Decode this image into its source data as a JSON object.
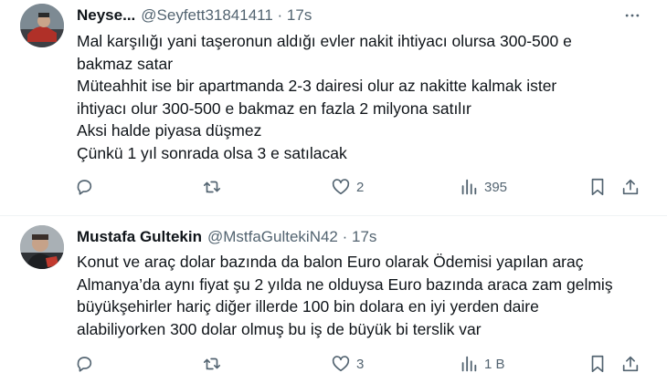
{
  "tweets": [
    {
      "display_name": "Neyse...",
      "handle_time": "@Seyfett31841411 · 17s",
      "lines": [
        "Mal karşılığı yani taşeronun aldığı evler nakit ihtiyacı olursa 300-500 e",
        "bakmaz satar",
        "Müteahhit ise bir apartmanda 2-3 dairesi olur az nakitte kalmak ister",
        "ihtiyacı olur 300-500 e bakmaz en fazla 2 milyona satılır",
        "Aksi halde piyasa düşmez",
        "Çünkü 1 yıl sonrada olsa 3 e satılacak"
      ],
      "replies": "",
      "retweets": "",
      "likes": "2",
      "views": "395"
    },
    {
      "display_name": "Mustafa Gultekin",
      "handle_time": "@MstfaGultekiN42 · 17s",
      "lines": [
        "Konut ve araç dolar bazında da balon Euro olarak Ödemisi yapılan araç",
        "Almanya’da aynı fiyat şu 2 yılda ne olduysa Euro bazında araca zam gelmiş",
        "büyükşehirler hariç diğer illerde 100 bin dolara en iyi yerden daire",
        "alabiliyorken 300 dolar olmuş bu iş de büyük bi terslik var"
      ],
      "replies": "",
      "retweets": "",
      "likes": "3",
      "views": "1 B"
    }
  ],
  "icons": {
    "more": "more-dots-icon",
    "reply": "reply-icon",
    "retweet": "retweet-icon",
    "like": "heart-icon",
    "views": "views-icon",
    "bookmark": "bookmark-icon",
    "share": "share-icon"
  },
  "colors": {
    "text": "#0f1419",
    "secondary": "#536471",
    "divider": "#eff3f4"
  }
}
